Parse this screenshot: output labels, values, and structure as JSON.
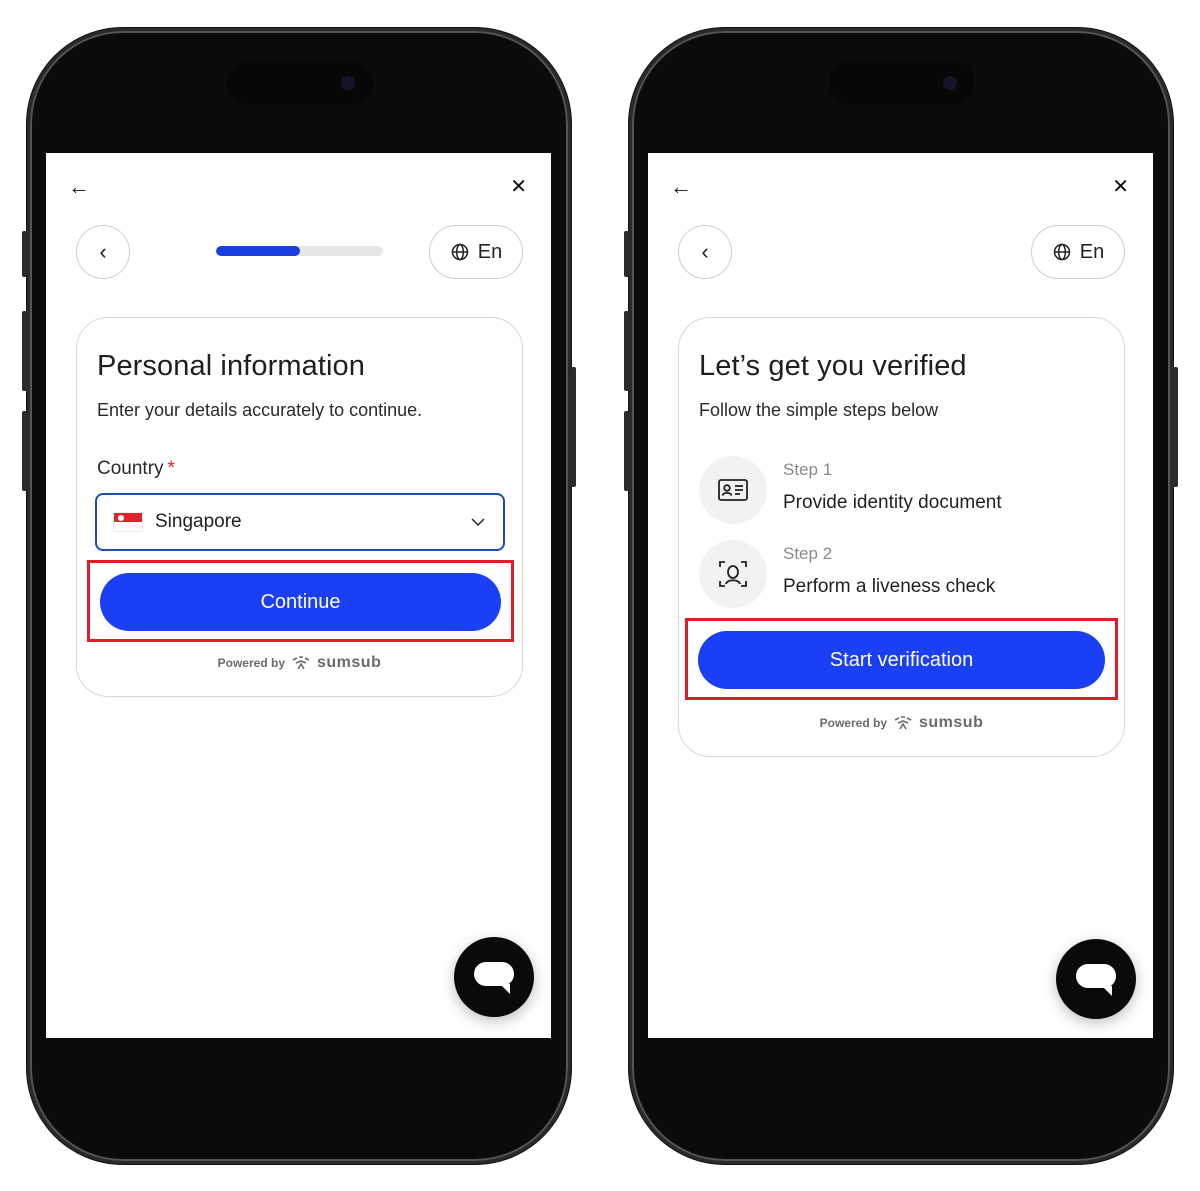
{
  "left_phone": {
    "topbar": {
      "back_glyph": "←",
      "close_glyph": "✕"
    },
    "nav": {
      "back_glyph": "‹",
      "progress": 0.5,
      "language": "En"
    },
    "card": {
      "title": "Personal information",
      "subtitle": "Enter your details accurately to continue.",
      "country_label": "Country",
      "required_mark": "*",
      "country_value": "Singapore",
      "continue_label": "Continue",
      "powered_by": "Powered by",
      "brand": "sumsub"
    }
  },
  "right_phone": {
    "topbar": {
      "back_glyph": "←",
      "close_glyph": "✕"
    },
    "nav": {
      "back_glyph": "‹",
      "language": "En"
    },
    "card": {
      "title": "Let’s get you verified",
      "subtitle": "Follow the simple steps below",
      "steps": [
        {
          "label": "Step 1",
          "title": "Provide identity document",
          "icon": "id-card-icon"
        },
        {
          "label": "Step 2",
          "title": "Perform a liveness check",
          "icon": "face-scan-icon"
        }
      ],
      "start_label": "Start verification",
      "powered_by": "Powered by",
      "brand": "sumsub"
    }
  },
  "colors": {
    "primary": "#1a3ff5",
    "progress_fill": "#1a3fe0",
    "highlight": "#e01e2a",
    "select_border": "#1b4fb8",
    "required": "#e02424"
  }
}
